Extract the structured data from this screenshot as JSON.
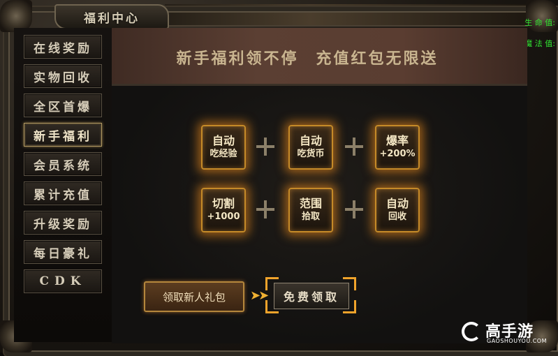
{
  "window": {
    "title": "福利中心"
  },
  "stats": {
    "hp_label": "生 命 值:",
    "mp_label": "魔 法 值:"
  },
  "sidebar": {
    "items": [
      {
        "label": "在线奖励",
        "active": false
      },
      {
        "label": "实物回收",
        "active": false
      },
      {
        "label": "全区首爆",
        "active": false
      },
      {
        "label": "新手福利",
        "active": true
      },
      {
        "label": "会员系统",
        "active": false
      },
      {
        "label": "累计充值",
        "active": false
      },
      {
        "label": "升级奖励",
        "active": false
      },
      {
        "label": "每日豪礼",
        "active": false
      },
      {
        "label": "CDK",
        "active": false
      }
    ]
  },
  "banner": {
    "text": "新手福利领不停　充值红包无限送"
  },
  "benefits": [
    {
      "line1": "自动",
      "line2": "吃经验"
    },
    {
      "line1": "自动",
      "line2": "吃货币"
    },
    {
      "line1": "爆率",
      "line2": "+200%"
    },
    {
      "line1": "切割",
      "line2": "+1000"
    },
    {
      "line1": "范围",
      "line2": "拾取"
    },
    {
      "line1": "自动",
      "line2": "回收"
    }
  ],
  "gift": {
    "label": "领取新人礼包",
    "arrow": "➤➤",
    "claim_button": "免费领取"
  },
  "watermark": {
    "brand": "高手游",
    "domain": "GAOSHOUYOU.COM"
  },
  "colors": {
    "accent_glow": "#f0a32b",
    "stat_text": "#32e532",
    "menu_text": "#d6cdb9"
  }
}
